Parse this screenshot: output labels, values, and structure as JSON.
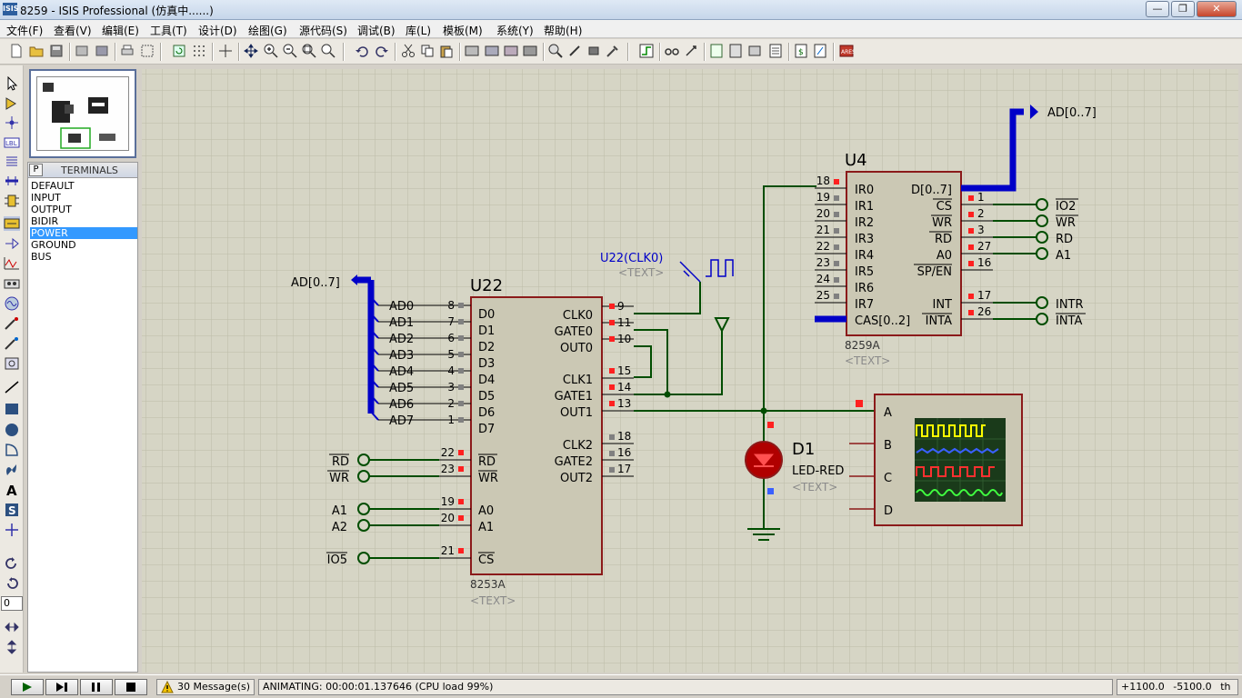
{
  "window": {
    "title": "8259 - ISIS Professional (仿真中......)",
    "min_label": "—",
    "max_label": "❐",
    "close_label": "✕"
  },
  "menu": [
    "文件(F)",
    "查看(V)",
    "编辑(E)",
    "工具(T)",
    "设计(D)",
    "绘图(G)",
    "源代码(S)",
    "调试(B)",
    "库(L)",
    "模板(M)",
    "系统(Y)",
    "帮助(H)"
  ],
  "terminals_panel": {
    "p_button": "P",
    "title": "TERMINALS",
    "items": [
      "DEFAULT",
      "INPUT",
      "OUTPUT",
      "BIDIR",
      "POWER",
      "GROUND",
      "BUS"
    ],
    "selected": "POWER"
  },
  "rotation_value": "0",
  "status": {
    "messages": "30 Message(s)",
    "animating": "ANIMATING: 00:00:01.137646 (CPU load 99%)",
    "coord_x": "+1100.0",
    "coord_y": "-5100.0",
    "unit": "th"
  },
  "schematic": {
    "u22": {
      "ref": "U22",
      "part": "8253A",
      "text": "<TEXT>",
      "left_pins": [
        "D0",
        "D1",
        "D2",
        "D3",
        "D4",
        "D5",
        "D6",
        "D7"
      ],
      "left_nums": [
        "8",
        "7",
        "6",
        "5",
        "4",
        "3",
        "2",
        "1"
      ],
      "bus_nets": [
        "AD0",
        "AD1",
        "AD2",
        "AD3",
        "AD4",
        "AD5",
        "AD6",
        "AD7"
      ],
      "ctrl_pins": [
        "RD",
        "WR",
        "A0",
        "A1",
        "CS"
      ],
      "ctrl_nums": [
        "22",
        "23",
        "19",
        "20",
        "21"
      ],
      "right_pins": [
        "CLK0",
        "GATE0",
        "OUT0",
        "CLK1",
        "GATE1",
        "OUT1",
        "CLK2",
        "GATE2",
        "OUT2"
      ],
      "right_nums": [
        "9",
        "11",
        "10",
        "15",
        "14",
        "13",
        "18",
        "16",
        "17"
      ]
    },
    "u22_terminals": [
      "RD",
      "WR",
      "A1",
      "A2",
      "IO5"
    ],
    "bus_label_left": "AD[0..7]",
    "clock_gen_label": "U22(CLK0)",
    "clock_gen_text": "<TEXT>",
    "u4": {
      "ref": "U4",
      "part": "8259A",
      "text": "<TEXT>",
      "left_pins": [
        "IR0",
        "IR1",
        "IR2",
        "IR3",
        "IR4",
        "IR5",
        "IR6",
        "IR7",
        "CAS[0..2]"
      ],
      "left_nums": [
        "18",
        "19",
        "20",
        "21",
        "22",
        "23",
        "24",
        "25"
      ],
      "right_pins": [
        "D[0..7]",
        "CS",
        "WR",
        "RD",
        "A0",
        "SP/EN",
        "INT",
        "INTA"
      ],
      "right_nums": [
        "1",
        "2",
        "3",
        "27",
        "16",
        "17",
        "26"
      ]
    },
    "u4_terminals": [
      "IO2",
      "WR",
      "RD",
      "A1",
      "INTR",
      "INTA"
    ],
    "bus_label_right": "AD[0..7]",
    "led": {
      "ref": "D1",
      "part": "LED-RED",
      "text": "<TEXT>"
    },
    "scope_channels": [
      "A",
      "B",
      "C",
      "D"
    ]
  },
  "colors": {
    "canvas_bg": "#d6d5c5",
    "wire": "#004d00",
    "bus": "#0000c8",
    "component_fill": "#cbc8b4",
    "component_border": "#8b1a1a",
    "pin_active": "#ff2020",
    "pin_idle": "#808080",
    "text_placeholder": "#8a8a8a",
    "scope_yellow": "#ffff00",
    "scope_blue": "#3a60ff",
    "scope_red": "#ff3030",
    "scope_green": "#40ff40"
  }
}
